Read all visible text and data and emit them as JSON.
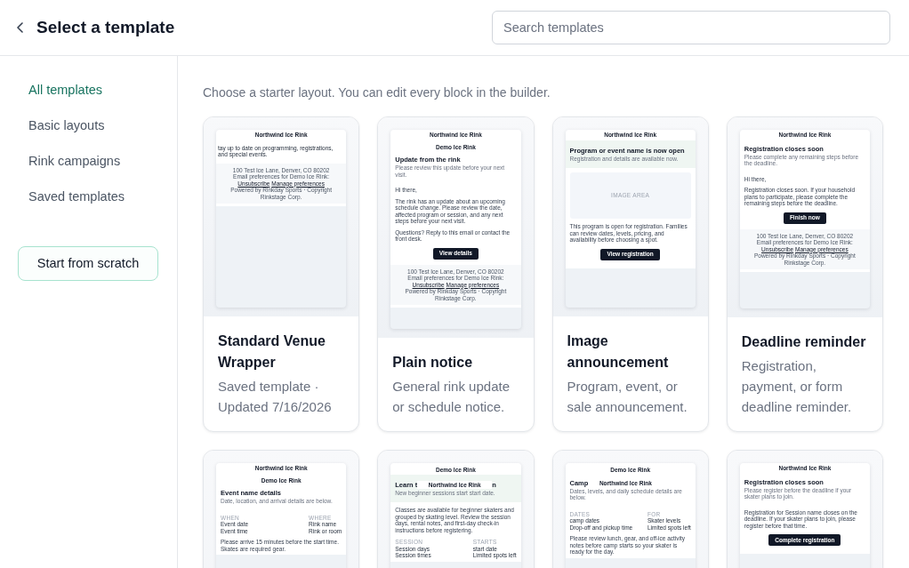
{
  "header": {
    "title": "Select a template",
    "search": {
      "placeholder": "Search templates"
    }
  },
  "sidebar": {
    "items": [
      {
        "label": "All templates",
        "selected": true
      },
      {
        "label": "Basic layouts",
        "selected": false
      },
      {
        "label": "Rink campaigns",
        "selected": false
      },
      {
        "label": "Saved templates",
        "selected": false
      }
    ],
    "button": "Start from scratch"
  },
  "main": {
    "intro": "Choose a starter layout. You can edit every block in the builder.",
    "templates": [
      {
        "title": "Standard Venue Wrapper",
        "description": "Saved template · Updated 7/16/2026",
        "preview": [
          {
            "kind": "tab",
            "text": "Northwind Ice Rink"
          },
          {
            "kind": "lead",
            "text": "tay up to date on programming, registrations, and special events."
          },
          {
            "kind": "footer",
            "address": "100 Test Ice Lane, Denver, CO 80202",
            "preferences": "Email preferences for Demo Ice Rink:",
            "links": [
              "Unsubscribe",
              "Manage preferences"
            ],
            "credit": "Powered by Rinkday Sports · Copyright Rinkstage Corp."
          }
        ]
      },
      {
        "title": "Plain notice",
        "description": "General rink update or schedule notice.",
        "preview": [
          {
            "kind": "tab",
            "text": "Northwind Ice Rink"
          },
          {
            "kind": "brand",
            "text": "Demo Ice Rink"
          },
          {
            "kind": "hero",
            "tinted": false,
            "title": "Update from the rink",
            "subtitle": "Please review this update before your next visit."
          },
          {
            "kind": "text",
            "text": "Hi there,"
          },
          {
            "kind": "text",
            "text": "The rink has an update about an upcoming schedule change. Please review the date, affected program or session, and any next steps before your next visit."
          },
          {
            "kind": "text",
            "text": "Questions? Reply to this email or contact the front desk."
          },
          {
            "kind": "button",
            "label": "View details"
          },
          {
            "kind": "footer",
            "address": "100 Test Ice Lane, Denver, CO 80202",
            "preferences": "Email preferences for Demo Ice Rink:",
            "links": [
              "Unsubscribe",
              "Manage preferences"
            ],
            "credit": "Powered by Rinkday Sports · Copyright Rinkstage Corp."
          }
        ]
      },
      {
        "title": "Image announcement",
        "description": "Program, event, or sale announcement.",
        "preview": [
          {
            "kind": "tab",
            "text": "Northwind Ice Rink"
          },
          {
            "kind": "hero",
            "tinted": true,
            "title": "Program or event name is now open",
            "subtitle": "Registration and details are available now."
          },
          {
            "kind": "image",
            "label": "IMAGE AREA"
          },
          {
            "kind": "text",
            "text": "This program is open for registration. Families can review dates, levels, pricing, and availability before choosing a spot."
          },
          {
            "kind": "button",
            "label": "View registration"
          }
        ]
      },
      {
        "title": "Deadline reminder",
        "description": "Registration, payment, or form deadline reminder.",
        "preview": [
          {
            "kind": "tab",
            "text": "Northwind Ice Rink"
          },
          {
            "kind": "hero",
            "tinted": false,
            "title": "Registration closes soon",
            "subtitle": "Please complete any remaining steps before the deadline."
          },
          {
            "kind": "text",
            "text": "Hi there,"
          },
          {
            "kind": "text",
            "text": "Registration closes soon. If your household plans to participate, please complete the remaining steps before the deadline."
          },
          {
            "kind": "button",
            "label": "Finish now"
          },
          {
            "kind": "footer",
            "address": "100 Test Ice Lane, Denver, CO 80202",
            "preferences": "Email preferences for Demo Ice Rink:",
            "links": [
              "Unsubscribe",
              "Manage preferences"
            ],
            "credit": "Powered by Rinkday Sports · Copyright Rinkstage Corp."
          }
        ]
      },
      {
        "preview": [
          {
            "kind": "tab",
            "text": "Northwind Ice Rink"
          },
          {
            "kind": "brand",
            "text": "Demo Ice Rink"
          },
          {
            "kind": "hero",
            "tinted": false,
            "title": "Event name details",
            "subtitle": "Date, location, and arrival details are below."
          },
          {
            "kind": "details",
            "columns": [
              {
                "label": "WHEN",
                "lines": [
                  "Event date",
                  "Event time"
                ]
              },
              {
                "label": "WHERE",
                "lines": [
                  "Rink name",
                  "Rink or room"
                ]
              }
            ]
          },
          {
            "kind": "text",
            "text": "Please arrive 15 minutes before the start time. Skates are required gear."
          }
        ]
      },
      {
        "preview": [
          {
            "kind": "brand",
            "text": "Demo Ice Rink"
          },
          {
            "kind": "hero",
            "tinted": true,
            "title": "Learn t",
            "overlay": "Northwind Ice Rink",
            "title_end": "n",
            "subtitle": "New beginner sessions start start date."
          },
          {
            "kind": "text",
            "text": "Classes are available for beginner skaters and grouped by skating level. Review the session days, rental notes, and first-day check-in instructions before registering."
          },
          {
            "kind": "details",
            "columns": [
              {
                "label": "SESSION",
                "lines": [
                  "Session days",
                  "Session times"
                ]
              },
              {
                "label": "STARTS",
                "lines": [
                  "start date",
                  "Limited spots left"
                ]
              }
            ]
          }
        ]
      },
      {
        "preview": [
          {
            "kind": "brand",
            "text": "Demo Ice Rink"
          },
          {
            "kind": "hero",
            "tinted": false,
            "title": "Camp",
            "overlay": "Northwind Ice Rink",
            "subtitle": "Dates, levels, and daily schedule details are below."
          },
          {
            "kind": "details",
            "columns": [
              {
                "label": "DATES",
                "lines": [
                  "camp dates",
                  "Drop-off and pickup time"
                ]
              },
              {
                "label": "FOR",
                "lines": [
                  "Skater levels",
                  "Limited spots left"
                ]
              }
            ]
          },
          {
            "kind": "text",
            "text": "Please review lunch, gear, and off-ice activity notes before camp starts so your skater is ready for the day."
          }
        ]
      },
      {
        "preview": [
          {
            "kind": "tab",
            "text": "Northwind Ice Rink"
          },
          {
            "kind": "hero",
            "tinted": false,
            "title": "Registration closes soon",
            "subtitle": "Please register before the deadline if your skater plans to join."
          },
          {
            "kind": "text",
            "text": "Registration for Session name closes on the deadline. If your skater plans to join, please register before that time."
          },
          {
            "kind": "button",
            "label": "Complete registration"
          }
        ]
      }
    ]
  }
}
